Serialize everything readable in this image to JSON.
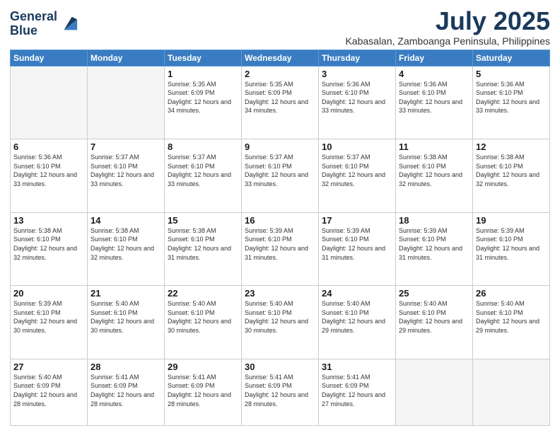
{
  "logo": {
    "line1": "General",
    "line2": "Blue"
  },
  "title": "July 2025",
  "subtitle": "Kabasalan, Zamboanga Peninsula, Philippines",
  "days_header": [
    "Sunday",
    "Monday",
    "Tuesday",
    "Wednesday",
    "Thursday",
    "Friday",
    "Saturday"
  ],
  "weeks": [
    [
      {
        "day": "",
        "info": ""
      },
      {
        "day": "",
        "info": ""
      },
      {
        "day": "1",
        "info": "Sunrise: 5:35 AM\nSunset: 6:09 PM\nDaylight: 12 hours and 34 minutes."
      },
      {
        "day": "2",
        "info": "Sunrise: 5:35 AM\nSunset: 6:09 PM\nDaylight: 12 hours and 34 minutes."
      },
      {
        "day": "3",
        "info": "Sunrise: 5:36 AM\nSunset: 6:10 PM\nDaylight: 12 hours and 33 minutes."
      },
      {
        "day": "4",
        "info": "Sunrise: 5:36 AM\nSunset: 6:10 PM\nDaylight: 12 hours and 33 minutes."
      },
      {
        "day": "5",
        "info": "Sunrise: 5:36 AM\nSunset: 6:10 PM\nDaylight: 12 hours and 33 minutes."
      }
    ],
    [
      {
        "day": "6",
        "info": "Sunrise: 5:36 AM\nSunset: 6:10 PM\nDaylight: 12 hours and 33 minutes."
      },
      {
        "day": "7",
        "info": "Sunrise: 5:37 AM\nSunset: 6:10 PM\nDaylight: 12 hours and 33 minutes."
      },
      {
        "day": "8",
        "info": "Sunrise: 5:37 AM\nSunset: 6:10 PM\nDaylight: 12 hours and 33 minutes."
      },
      {
        "day": "9",
        "info": "Sunrise: 5:37 AM\nSunset: 6:10 PM\nDaylight: 12 hours and 33 minutes."
      },
      {
        "day": "10",
        "info": "Sunrise: 5:37 AM\nSunset: 6:10 PM\nDaylight: 12 hours and 32 minutes."
      },
      {
        "day": "11",
        "info": "Sunrise: 5:38 AM\nSunset: 6:10 PM\nDaylight: 12 hours and 32 minutes."
      },
      {
        "day": "12",
        "info": "Sunrise: 5:38 AM\nSunset: 6:10 PM\nDaylight: 12 hours and 32 minutes."
      }
    ],
    [
      {
        "day": "13",
        "info": "Sunrise: 5:38 AM\nSunset: 6:10 PM\nDaylight: 12 hours and 32 minutes."
      },
      {
        "day": "14",
        "info": "Sunrise: 5:38 AM\nSunset: 6:10 PM\nDaylight: 12 hours and 32 minutes."
      },
      {
        "day": "15",
        "info": "Sunrise: 5:38 AM\nSunset: 6:10 PM\nDaylight: 12 hours and 31 minutes."
      },
      {
        "day": "16",
        "info": "Sunrise: 5:39 AM\nSunset: 6:10 PM\nDaylight: 12 hours and 31 minutes."
      },
      {
        "day": "17",
        "info": "Sunrise: 5:39 AM\nSunset: 6:10 PM\nDaylight: 12 hours and 31 minutes."
      },
      {
        "day": "18",
        "info": "Sunrise: 5:39 AM\nSunset: 6:10 PM\nDaylight: 12 hours and 31 minutes."
      },
      {
        "day": "19",
        "info": "Sunrise: 5:39 AM\nSunset: 6:10 PM\nDaylight: 12 hours and 31 minutes."
      }
    ],
    [
      {
        "day": "20",
        "info": "Sunrise: 5:39 AM\nSunset: 6:10 PM\nDaylight: 12 hours and 30 minutes."
      },
      {
        "day": "21",
        "info": "Sunrise: 5:40 AM\nSunset: 6:10 PM\nDaylight: 12 hours and 30 minutes."
      },
      {
        "day": "22",
        "info": "Sunrise: 5:40 AM\nSunset: 6:10 PM\nDaylight: 12 hours and 30 minutes."
      },
      {
        "day": "23",
        "info": "Sunrise: 5:40 AM\nSunset: 6:10 PM\nDaylight: 12 hours and 30 minutes."
      },
      {
        "day": "24",
        "info": "Sunrise: 5:40 AM\nSunset: 6:10 PM\nDaylight: 12 hours and 29 minutes."
      },
      {
        "day": "25",
        "info": "Sunrise: 5:40 AM\nSunset: 6:10 PM\nDaylight: 12 hours and 29 minutes."
      },
      {
        "day": "26",
        "info": "Sunrise: 5:40 AM\nSunset: 6:10 PM\nDaylight: 12 hours and 29 minutes."
      }
    ],
    [
      {
        "day": "27",
        "info": "Sunrise: 5:40 AM\nSunset: 6:09 PM\nDaylight: 12 hours and 28 minutes."
      },
      {
        "day": "28",
        "info": "Sunrise: 5:41 AM\nSunset: 6:09 PM\nDaylight: 12 hours and 28 minutes."
      },
      {
        "day": "29",
        "info": "Sunrise: 5:41 AM\nSunset: 6:09 PM\nDaylight: 12 hours and 28 minutes."
      },
      {
        "day": "30",
        "info": "Sunrise: 5:41 AM\nSunset: 6:09 PM\nDaylight: 12 hours and 28 minutes."
      },
      {
        "day": "31",
        "info": "Sunrise: 5:41 AM\nSunset: 6:09 PM\nDaylight: 12 hours and 27 minutes."
      },
      {
        "day": "",
        "info": ""
      },
      {
        "day": "",
        "info": ""
      }
    ]
  ]
}
